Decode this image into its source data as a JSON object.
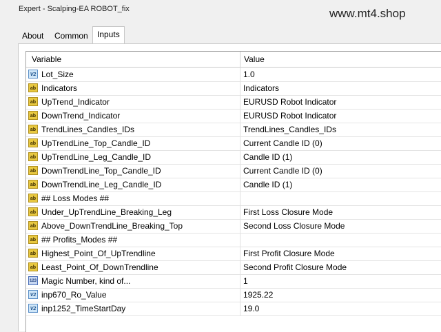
{
  "window": {
    "title": "Expert - Scalping-EA ROBOT_fix",
    "watermark": "www.mt4.shop"
  },
  "tabs": [
    {
      "label": "About",
      "active": false
    },
    {
      "label": "Common",
      "active": false
    },
    {
      "label": "Inputs",
      "active": true
    }
  ],
  "table": {
    "headers": {
      "variable": "Variable",
      "value": "Value"
    },
    "rows": [
      {
        "icon": "double-icon",
        "variable": "Lot_Size",
        "value": "1.0"
      },
      {
        "icon": "string-icon",
        "variable": "Indicators",
        "value": "Indicators"
      },
      {
        "icon": "string-icon",
        "variable": "UpTrend_Indicator",
        "value": "EURUSD Robot Indicator"
      },
      {
        "icon": "string-icon",
        "variable": "DownTrend_Indicator",
        "value": "EURUSD Robot Indicator"
      },
      {
        "icon": "string-icon",
        "variable": "TrendLines_Candles_IDs",
        "value": "TrendLines_Candles_IDs"
      },
      {
        "icon": "string-icon",
        "variable": "UpTrendLine_Top_Candle_ID",
        "value": "Current Candle ID (0)"
      },
      {
        "icon": "string-icon",
        "variable": "UpTrendLine_Leg_Candle_ID",
        "value": "Candle ID (1)"
      },
      {
        "icon": "string-icon",
        "variable": "DownTrendLine_Top_Candle_ID",
        "value": "Current Candle ID (0)"
      },
      {
        "icon": "string-icon",
        "variable": "DownTrendLine_Leg_Candle_ID",
        "value": "Candle ID (1)"
      },
      {
        "icon": "string-icon",
        "variable": "## Loss Modes ##",
        "value": ""
      },
      {
        "icon": "string-icon",
        "variable": "Under_UpTrendLine_Breaking_Leg",
        "value": "First Loss Closure Mode"
      },
      {
        "icon": "string-icon",
        "variable": "Above_DownTrendLine_Breaking_Top",
        "value": "Second Loss Closure Mode"
      },
      {
        "icon": "string-icon",
        "variable": "## Profits_Modes ##",
        "value": ""
      },
      {
        "icon": "string-icon",
        "variable": "Highest_Point_Of_UpTrendline",
        "value": "First Profit Closure Mode"
      },
      {
        "icon": "string-icon",
        "variable": "Least_Point_Of_DownTrendline",
        "value": "Second Profit Closure Mode"
      },
      {
        "icon": "integer-icon",
        "variable": "Magic Number, kind of...",
        "value": "1"
      },
      {
        "icon": "double-icon",
        "variable": "inp670_Ro_Value",
        "value": "1925.22"
      },
      {
        "icon": "double-icon",
        "variable": "inp1252_TimeStartDay",
        "value": "19.0"
      }
    ]
  }
}
